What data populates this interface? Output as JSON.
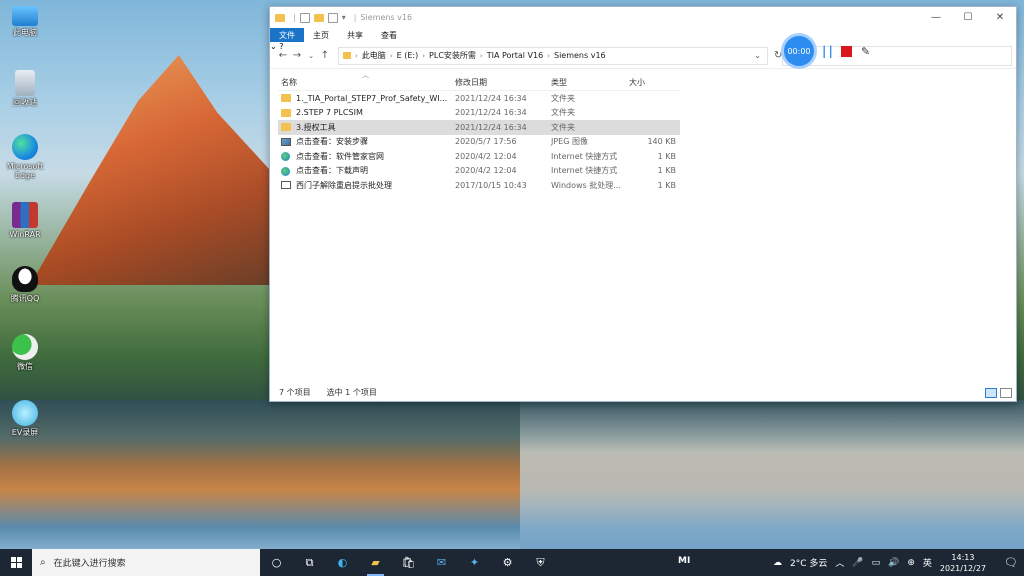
{
  "desktop": {
    "icons": [
      {
        "label": "此电脑"
      },
      {
        "label": "回收站"
      },
      {
        "label": "Microsoft Edge"
      },
      {
        "label": "WinRAR"
      },
      {
        "label": "腾讯QQ"
      },
      {
        "label": "微信"
      },
      {
        "label": "EV录屏"
      }
    ]
  },
  "window": {
    "title": "Siemens v16",
    "controls": {
      "minimize": "—",
      "maximize": "☐",
      "close": "✕"
    },
    "ribbon_tabs": [
      "文件",
      "主页",
      "共享",
      "查看"
    ],
    "help": "?",
    "breadcrumb": [
      "此电脑",
      "E (E:)",
      "PLC安装所需",
      "TIA Portal V16",
      "Siemens v16"
    ],
    "columns": {
      "name": "名称",
      "date": "修改日期",
      "type": "类型",
      "size": "大小"
    },
    "files": [
      {
        "icon": "folder",
        "name": "1._TIA_Portal_STEP7_Prof_Safety_WI...",
        "date": "2021/12/24 16:34",
        "type": "文件夹",
        "size": ""
      },
      {
        "icon": "folder",
        "name": "2.STEP 7 PLCSIM",
        "date": "2021/12/24 16:34",
        "type": "文件夹",
        "size": ""
      },
      {
        "icon": "folder",
        "name": "3.授权工具",
        "date": "2021/12/24 16:34",
        "type": "文件夹",
        "size": ""
      },
      {
        "icon": "image",
        "name": "点击查看：安装步骤",
        "date": "2020/5/7 17:56",
        "type": "JPEG 图像",
        "size": "140 KB"
      },
      {
        "icon": "link",
        "name": "点击查看：软件管家官网",
        "date": "2020/4/2 12:04",
        "type": "Internet 快捷方式",
        "size": "1 KB"
      },
      {
        "icon": "link",
        "name": "点击查看：下载声明",
        "date": "2020/4/2 12:04",
        "type": "Internet 快捷方式",
        "size": "1 KB"
      },
      {
        "icon": "bat",
        "name": "西门子解除重启提示批处理",
        "date": "2017/10/15 10:43",
        "type": "Windows 批处理...",
        "size": "1 KB"
      }
    ],
    "status": {
      "count": "7 个项目",
      "selected": "选中 1 个项目"
    }
  },
  "recorder": {
    "time": "00:00"
  },
  "taskbar": {
    "search_placeholder": "在此键入进行搜索",
    "weather": "2°C 多云",
    "ime": "英",
    "time": "14:13",
    "date": "2021/12/27",
    "mi": "MI"
  },
  "colors": {
    "accent": "#1a73c7",
    "recorder": "#2d8cf0",
    "stop": "#d9161b",
    "taskbar": "#1c2733"
  }
}
